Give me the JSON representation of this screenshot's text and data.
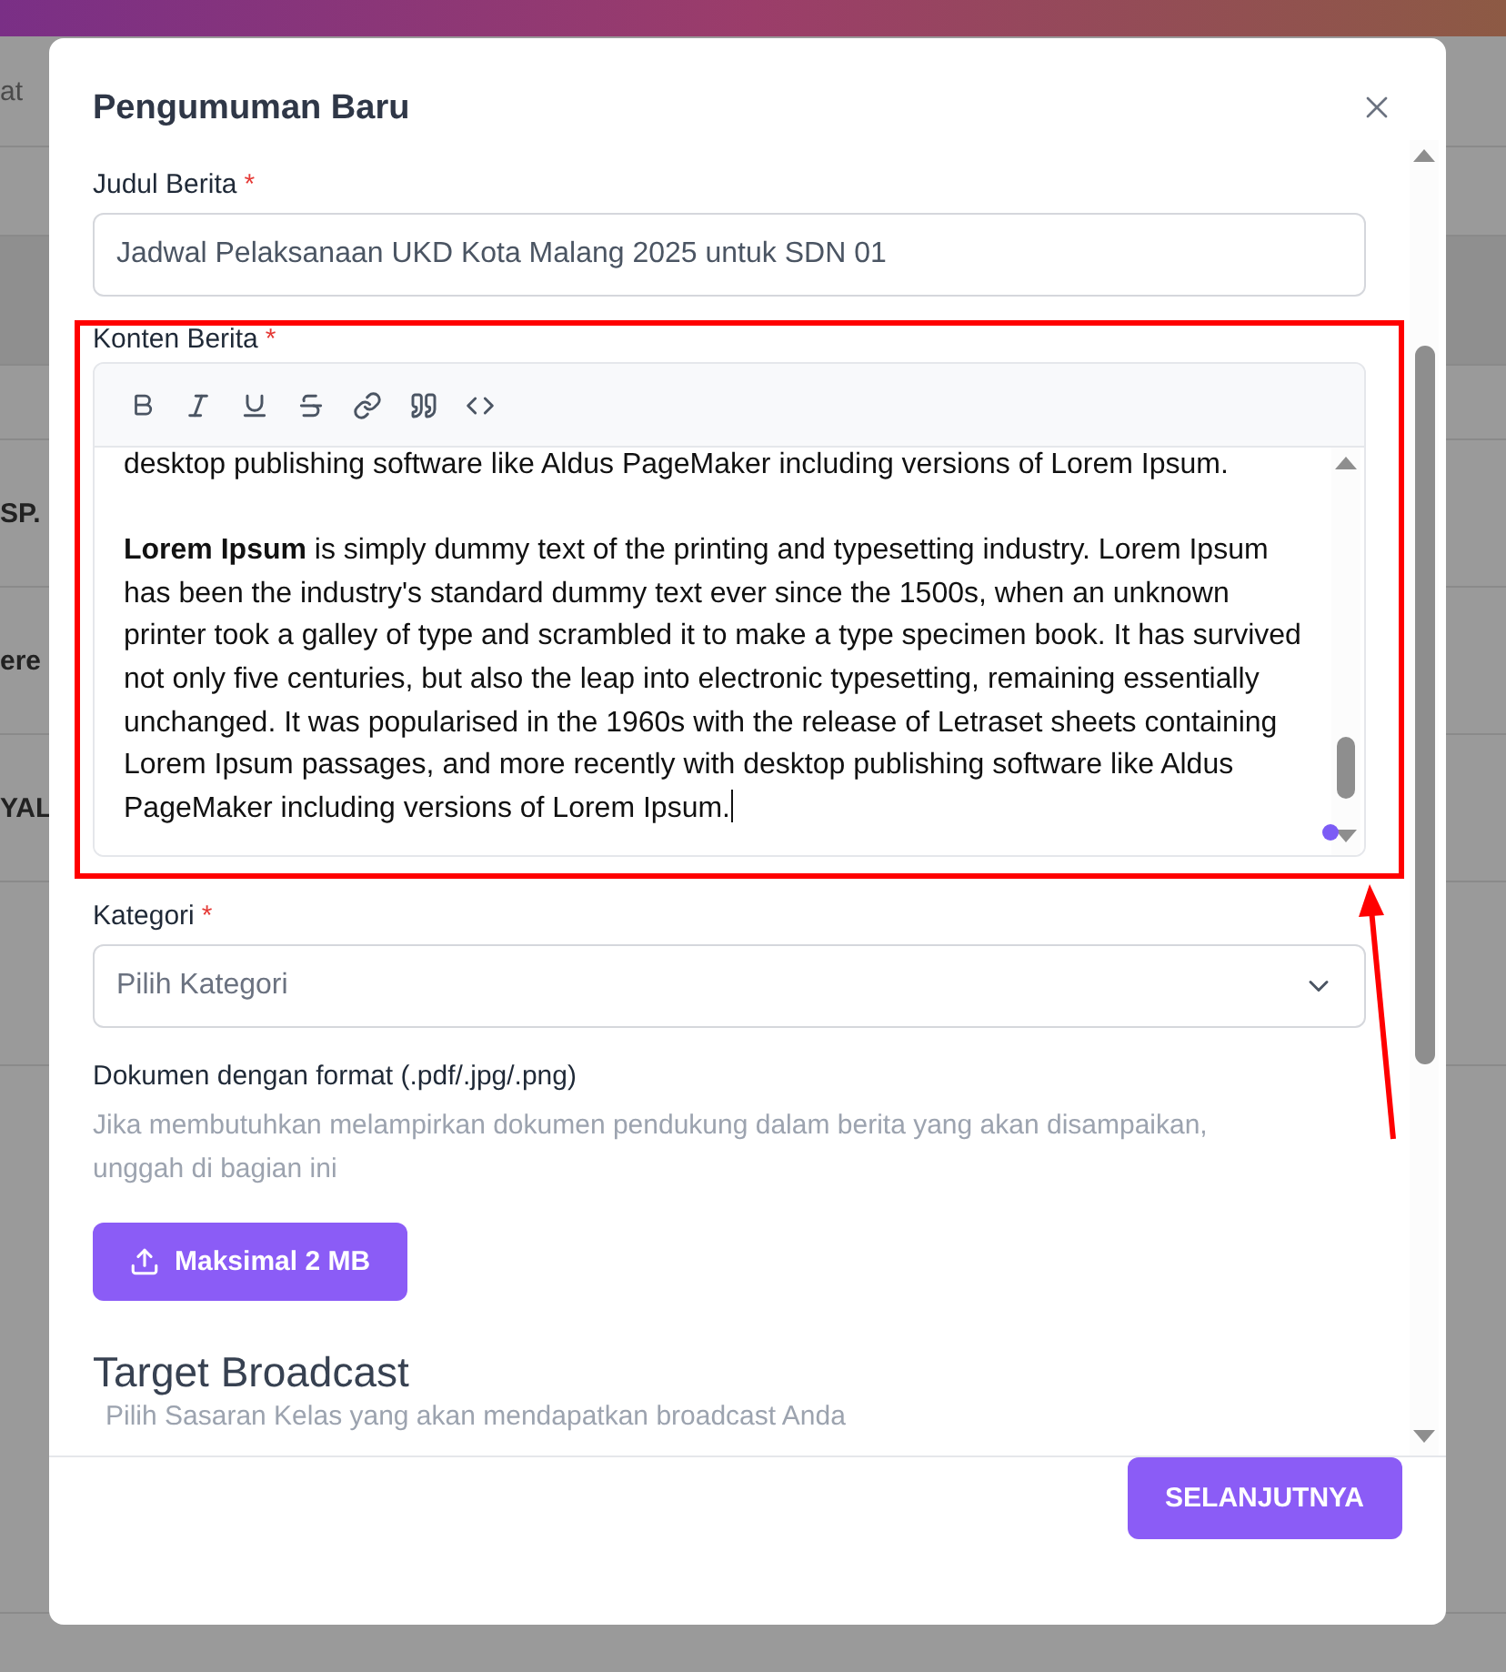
{
  "background": {
    "fragments": [
      "at",
      "SP.",
      "ere",
      "YAL"
    ]
  },
  "modal": {
    "title": "Pengumuman Baru",
    "title_field": {
      "label": "Judul Berita",
      "required_mark": "*",
      "value": "Jadwal Pelaksanaan UKD Kota Malang 2025 untuk SDN 01"
    },
    "content_field": {
      "label": "Konten Berita",
      "required_mark": "*",
      "toolbar": [
        {
          "kind": "bold"
        },
        {
          "kind": "italic"
        },
        {
          "kind": "underline"
        },
        {
          "kind": "strike"
        },
        {
          "kind": "link"
        },
        {
          "kind": "quote"
        },
        {
          "kind": "code"
        }
      ],
      "paragraphs": [
        "desktop publishing software like Aldus PageMaker including versions of Lorem Ipsum.",
        "**Lorem Ipsum** is simply dummy text of the printing and typesetting industry. Lorem Ipsum has been the industry's standard dummy text ever since the 1500s, when an unknown printer took a galley of type and scrambled it to make a type specimen book. It has survived not only five centuries, but also the leap into electronic typesetting, remaining essentially unchanged. It was popularised in the 1960s with the release of Letraset sheets containing Lorem Ipsum passages, and more recently with desktop publishing software like Aldus PageMaker including versions of Lorem Ipsum."
      ]
    },
    "category_field": {
      "label": "Kategori",
      "required_mark": "*",
      "placeholder": "Pilih Kategori"
    },
    "document": {
      "label": "Dokumen dengan format (.pdf/.jpg/.png)",
      "help": "Jika membutuhkan melampirkan dokumen pendukung dalam berita yang akan disampaikan, unggah di bagian ini",
      "upload_button": "Maksimal 2 MB"
    },
    "target": {
      "title": "Target Broadcast",
      "subtitle": "Pilih Sasaran Kelas yang akan mendapatkan broadcast Anda"
    },
    "next_button": "SELANJUTNYA"
  }
}
